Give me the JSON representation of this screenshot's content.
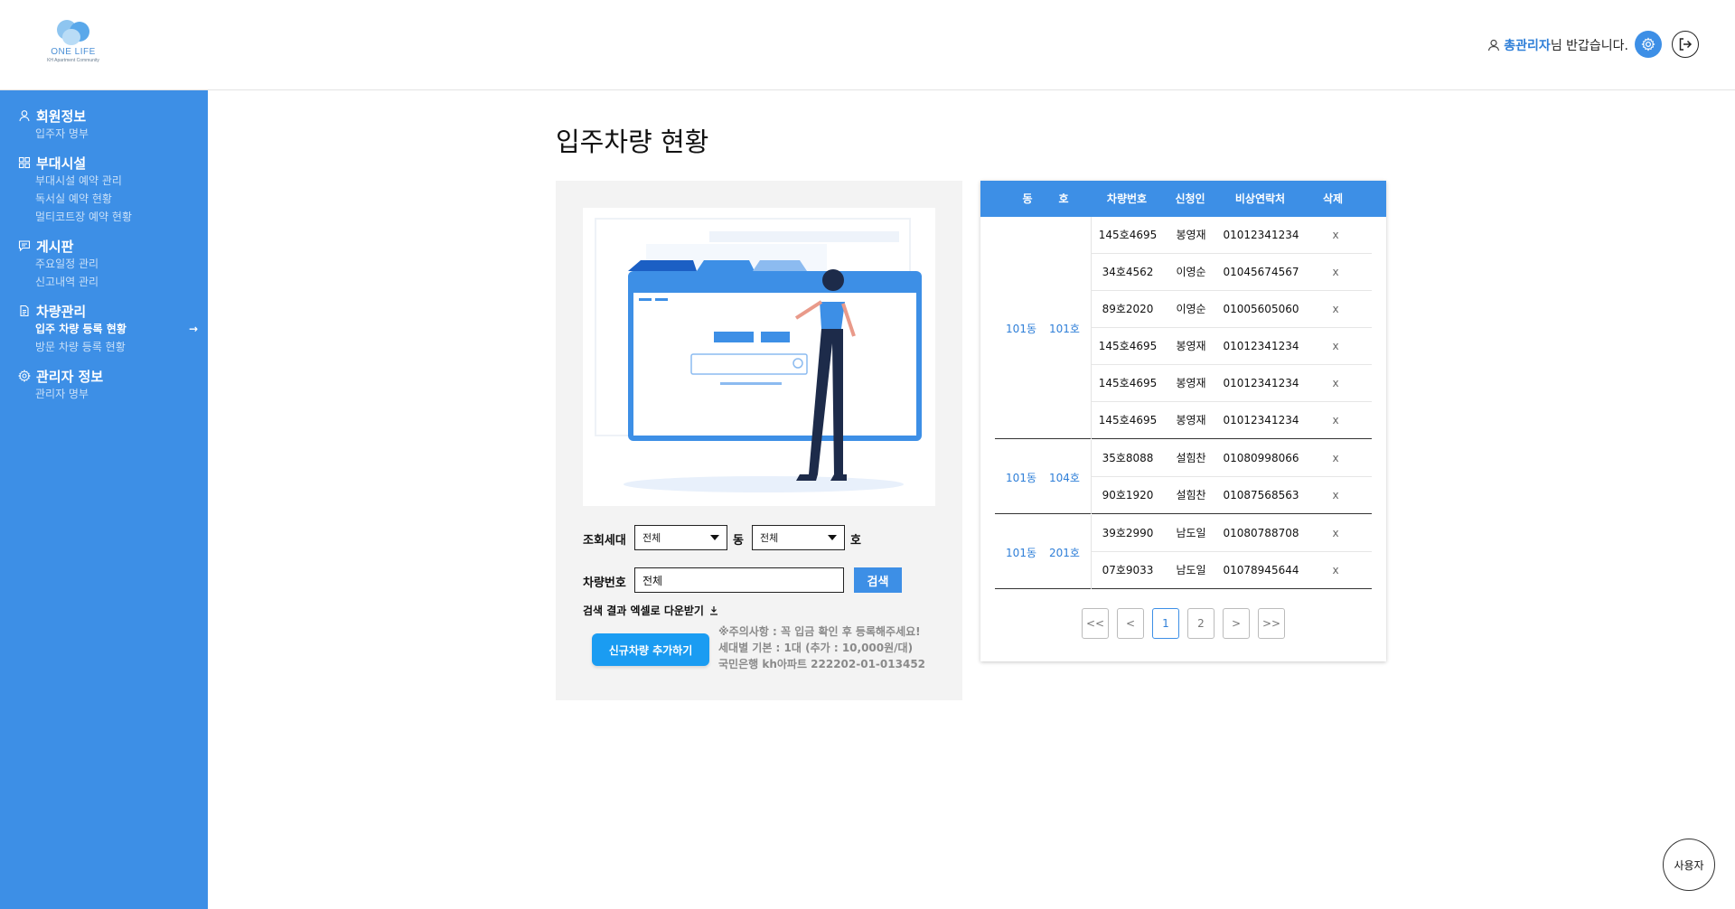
{
  "logo": {
    "name": "ONE LIFE",
    "tagline": "KH Apartment Community"
  },
  "header": {
    "admin_name": "총관리자",
    "greeting_suffix": "님 반갑습니다.",
    "settings_icon": "gear-icon",
    "logout_icon": "logout-icon"
  },
  "sidebar": {
    "groups": [
      {
        "title": "회원정보",
        "icon": "user-icon",
        "items": [
          "입주자 명부"
        ]
      },
      {
        "title": "부대시설",
        "icon": "grid-icon",
        "items": [
          "부대시설 예약 관리",
          "독서실 예약 현황",
          "멀티코트장 예약 현황"
        ]
      },
      {
        "title": "게시판",
        "icon": "message-icon",
        "items": [
          "주요일정 관리",
          "신고내역 관리"
        ]
      },
      {
        "title": "차량관리",
        "icon": "document-icon",
        "items": [
          "입주 차량 등록 현황",
          "방문 차량 등록 현황"
        ],
        "active_item": "입주 차량 등록 현황"
      },
      {
        "title": "관리자 정보",
        "icon": "gear-icon",
        "items": [
          "관리자 명부"
        ]
      }
    ],
    "active_arrow": "→"
  },
  "page": {
    "title": "입주차량 현황"
  },
  "filter": {
    "household_label": "조회세대",
    "dong_value": "전체",
    "dong_suffix": "동",
    "ho_value": "전체",
    "ho_suffix": "호",
    "car_label": "차량번호",
    "car_value": "전체",
    "search_label": "검색",
    "excel_label": "검색 결과 엑셀로 다운받기",
    "add_label": "신규차량 추가하기",
    "notice_lines": [
      "※주의사항 : 꼭 입금 확인 후 등록해주세요!",
      "세대별 기본 : 1대 (추가 : 10,000원/대)",
      "국민은행 kh아파트 222202-01-013452"
    ]
  },
  "table": {
    "headers": {
      "dong": "동",
      "ho": "호",
      "car": "차량번호",
      "name": "신청인",
      "phone": "비상연락처",
      "del": "삭제"
    },
    "groups": [
      {
        "dong": "101동",
        "ho": "101호",
        "rows": [
          {
            "car": "145호4695",
            "name": "봉영재",
            "phone": "01012341234",
            "del": "x"
          },
          {
            "car": "34호4562",
            "name": "이영순",
            "phone": "01045674567",
            "del": "x"
          },
          {
            "car": "89호2020",
            "name": "이영순",
            "phone": "01005605060",
            "del": "x"
          },
          {
            "car": "145호4695",
            "name": "봉영재",
            "phone": "01012341234",
            "del": "x"
          },
          {
            "car": "145호4695",
            "name": "봉영재",
            "phone": "01012341234",
            "del": "x"
          },
          {
            "car": "145호4695",
            "name": "봉영재",
            "phone": "01012341234",
            "del": "x"
          }
        ]
      },
      {
        "dong": "101동",
        "ho": "104호",
        "rows": [
          {
            "car": "35호8088",
            "name": "설힘찬",
            "phone": "01080998066",
            "del": "x"
          },
          {
            "car": "90호1920",
            "name": "설힘찬",
            "phone": "01087568563",
            "del": "x"
          }
        ]
      },
      {
        "dong": "101동",
        "ho": "201호",
        "rows": [
          {
            "car": "39호2990",
            "name": "남도일",
            "phone": "01080788708",
            "del": "x"
          },
          {
            "car": "07호9033",
            "name": "남도일",
            "phone": "01078945644",
            "del": "x"
          }
        ]
      }
    ]
  },
  "pagination": {
    "first": "<<",
    "prev": "<",
    "pages": [
      "1",
      "2"
    ],
    "current": "1",
    "next": ">",
    "last": ">>"
  },
  "user_toggle": {
    "label": "사용자"
  },
  "colors": {
    "primary": "#3d8fe6",
    "add_button": "#1a9cf2",
    "accent_text": "#2f7fd8"
  }
}
